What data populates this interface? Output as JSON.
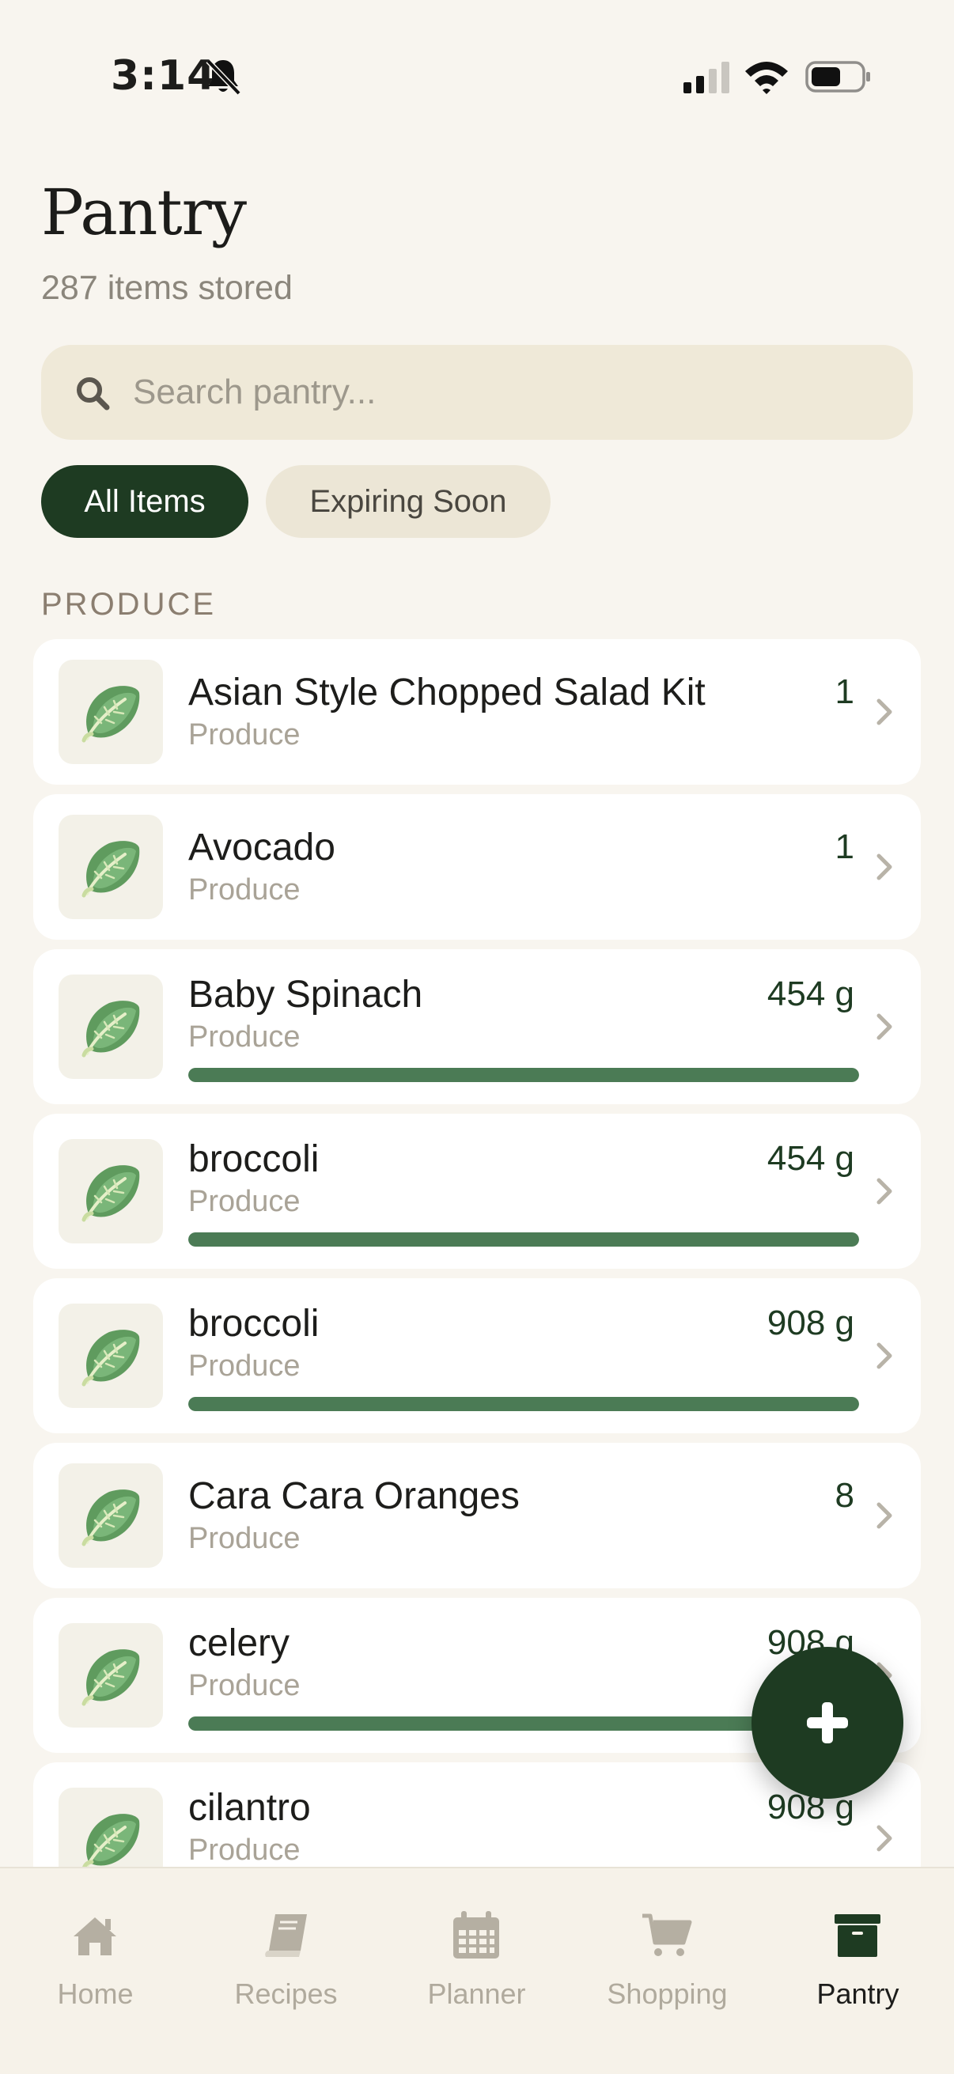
{
  "status_bar": {
    "time": "3:14"
  },
  "header": {
    "title": "Pantry",
    "subtitle": "287 items stored"
  },
  "search": {
    "placeholder": "Search pantry..."
  },
  "filters": [
    {
      "label": "All Items",
      "active": true
    },
    {
      "label": "Expiring Soon",
      "active": false
    }
  ],
  "section": {
    "label": "PRODUCE"
  },
  "items": [
    {
      "name": "Asian Style Chopped Salad Kit",
      "category": "Produce",
      "quantity": "1",
      "icon": "lettuce-icon"
    },
    {
      "name": "Avocado",
      "category": "Produce",
      "quantity": "1",
      "icon": "lettuce-icon"
    },
    {
      "name": "Baby Spinach",
      "category": "Produce",
      "quantity": "454 g",
      "icon": "lettuce-icon",
      "level": 1.0
    },
    {
      "name": "broccoli",
      "category": "Produce",
      "quantity": "454 g",
      "icon": "lettuce-icon",
      "level": 1.0
    },
    {
      "name": "broccoli",
      "category": "Produce",
      "quantity": "908 g",
      "icon": "lettuce-icon",
      "level": 1.0
    },
    {
      "name": "Cara Cara Oranges",
      "category": "Produce",
      "quantity": "8",
      "icon": "lettuce-icon"
    },
    {
      "name": "celery",
      "category": "Produce",
      "quantity": "908 g",
      "icon": "lettuce-icon",
      "level": 1.0
    },
    {
      "name": "cilantro",
      "category": "Produce",
      "quantity": "908 g",
      "icon": "lettuce-icon"
    }
  ],
  "fab": {
    "icon": "plus-icon"
  },
  "tabs": [
    {
      "label": "Home",
      "icon": "home-icon",
      "active": false
    },
    {
      "label": "Recipes",
      "icon": "book-icon",
      "active": false
    },
    {
      "label": "Planner",
      "icon": "calendar-icon",
      "active": false
    },
    {
      "label": "Shopping",
      "icon": "cart-icon",
      "active": false
    },
    {
      "label": "Pantry",
      "icon": "archive-box-icon",
      "active": true
    }
  ],
  "colors": {
    "accent": "#1e3b22",
    "progress": "#4b7b55",
    "background": "#f8f5ef"
  }
}
